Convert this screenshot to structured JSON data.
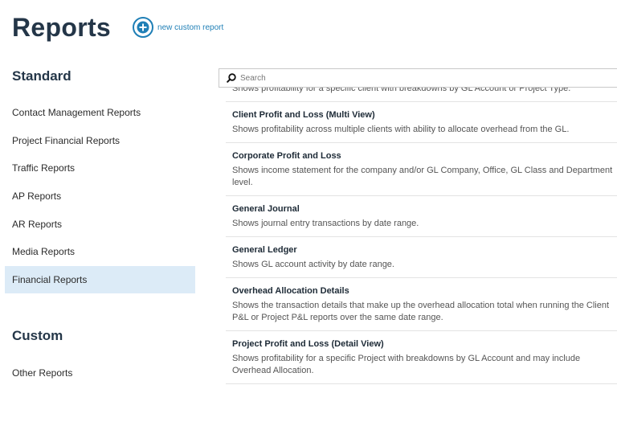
{
  "header": {
    "title": "Reports",
    "new_report_label": "new custom report"
  },
  "sidebar": {
    "standard_heading": "Standard",
    "standard_items": [
      {
        "label": "Contact Management Reports"
      },
      {
        "label": "Project Financial Reports"
      },
      {
        "label": "Traffic Reports"
      },
      {
        "label": "AP Reports"
      },
      {
        "label": "AR Reports"
      },
      {
        "label": "Media Reports"
      },
      {
        "label": "Financial Reports",
        "active": true
      }
    ],
    "custom_heading": "Custom",
    "custom_items": [
      {
        "label": "Other Reports"
      }
    ]
  },
  "search": {
    "placeholder": "Search",
    "value": ""
  },
  "reports": [
    {
      "name": "",
      "description": "Shows profitability for a specific client with breakdowns by GL Account or Project Type."
    },
    {
      "name": "Client Profit and Loss (Multi View)",
      "description": "Shows profitability across multiple clients with ability to allocate overhead from the GL."
    },
    {
      "name": "Corporate Profit and Loss",
      "description": "Shows income statement for the company and/or GL Company, Office, GL Class and Department level."
    },
    {
      "name": "General Journal",
      "description": "Shows journal entry transactions by date range."
    },
    {
      "name": "General Ledger",
      "description": "Shows GL account activity by date range."
    },
    {
      "name": "Overhead Allocation Details",
      "description": "Shows the transaction details that make up the overhead allocation total when running the Client P&L or Project P&L reports over the same date range."
    },
    {
      "name": "Project Profit and Loss (Detail View)",
      "description": "Shows profitability for a specific Project with breakdowns by GL Account and may include Overhead Allocation."
    }
  ],
  "colors": {
    "accent": "#1f7fb6",
    "heading": "#243648",
    "active_nav_bg": "#dcebf7"
  },
  "icons": {
    "new_report": "plus-circle-icon",
    "search": "search-icon"
  }
}
